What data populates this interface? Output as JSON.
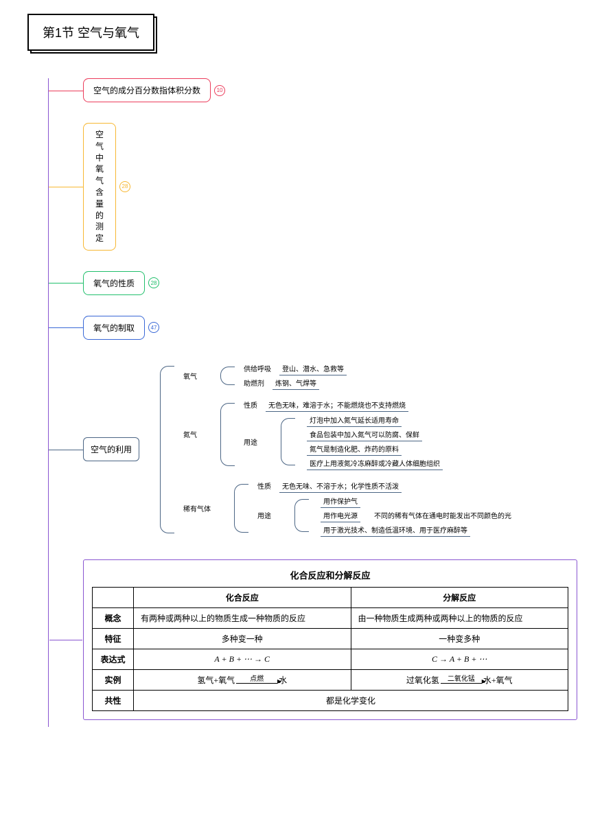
{
  "root": "第1节 空气与氧气",
  "branches": {
    "b1": {
      "label": "空气的成分百分数指体积分数",
      "badge": "10"
    },
    "b2": {
      "label": "空气中氧气含量的测定",
      "badge": "28"
    },
    "b3": {
      "label": "氧气的性质",
      "badge": "28"
    },
    "b4": {
      "label": "氧气的制取",
      "badge": "47"
    },
    "b5": {
      "label": "空气的利用"
    }
  },
  "tree": {
    "oxygen": {
      "name": "氧气",
      "i1": {
        "label": "供给呼吸",
        "detail": "登山、潜水、急救等"
      },
      "i2": {
        "label": "助燃剂",
        "detail": "炼钢、气焊等"
      }
    },
    "nitrogen": {
      "name": "氮气",
      "prop": {
        "label": "性质",
        "detail": "无色无味，难溶于水；不能燃烧也不支持燃烧"
      },
      "uses": {
        "label": "用途",
        "u1": "灯泡中加入氮气延长适用寿命",
        "u2": "食品包装中加入氮气可以防腐、保鲜",
        "u3": "氮气是制造化肥、炸药的原料",
        "u4": "医疗上用液氮冷冻麻醉或冷藏人体细胞组织"
      }
    },
    "noble": {
      "name": "稀有气体",
      "prop": {
        "label": "性质",
        "detail": "无色无味、不溶于水；化学性质不活泼"
      },
      "uses": {
        "label": "用途",
        "u1": "用作保护气",
        "u2": {
          "text": "用作电光源",
          "extra": "不同的稀有气体在通电时能发出不同颜色的光"
        },
        "u3": "用于激光技术、制造低温环境、用于医疗麻醉等"
      }
    }
  },
  "table": {
    "title": "化合反应和分解反应",
    "h1": "化合反应",
    "h2": "分解反应",
    "r1": {
      "h": "概念",
      "c1": "有两种或两种以上的物质生成一种物质的反应",
      "c2": "由一种物质生成两种或两种以上的物质的反应"
    },
    "r2": {
      "h": "特征",
      "c1": "多种变一种",
      "c2": "一种变多种"
    },
    "r3": {
      "h": "表达式",
      "c1": "A + B + ⋯ → C",
      "c2": "C → A + B + ⋯"
    },
    "r4": {
      "h": "实例",
      "c1_left": "氢气+氧气",
      "c1_top": "点燃",
      "c1_right": "水",
      "c2_left": "过氧化氢",
      "c2_top": "二氧化锰",
      "c2_right": "水+氧气"
    },
    "r5": {
      "h": "共性",
      "c": "都是化学变化"
    }
  }
}
